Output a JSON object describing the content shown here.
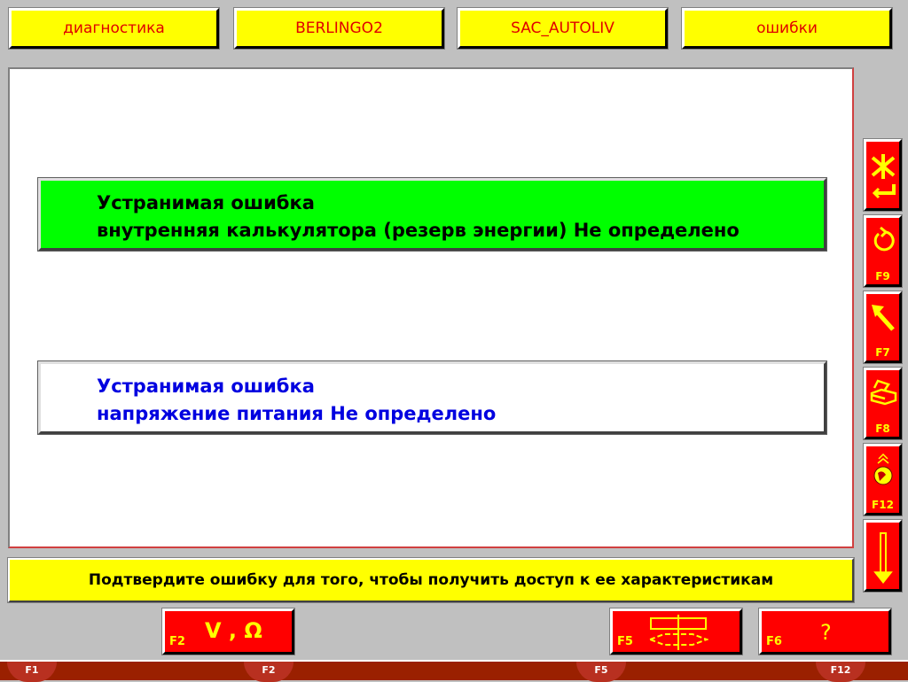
{
  "header": {
    "items": [
      "диагностика",
      "BERLINGO2",
      "SAC_AUTOLIV",
      "ошибки"
    ]
  },
  "faults": [
    {
      "line1": "Устранимая ошибка",
      "line2": "внутренняя калькулятора (резерв энергии) Не определено",
      "state": "selected",
      "bg": "#00ff00",
      "color": "#000000"
    },
    {
      "line1": "Устранимая ошибка",
      "line2": "напряжение питания Не определено",
      "state": "normal",
      "bg": "#ffffff",
      "color": "#0000e0"
    }
  ],
  "side_buttons": [
    {
      "icon": "confirm-icon",
      "key": ""
    },
    {
      "icon": "undo-icon",
      "key": "F9"
    },
    {
      "icon": "arrow-up-left-icon",
      "key": "F7"
    },
    {
      "icon": "print-icon",
      "key": "F8"
    },
    {
      "icon": "globe-icon",
      "key": "F12"
    },
    {
      "icon": "arrow-down-icon",
      "key": ""
    }
  ],
  "status": "Подтвердите ошибку для того, чтобы получить доступ к ее характеристикам",
  "bottom_buttons": [
    {
      "key": "F2",
      "label": "V , Ω"
    },
    {
      "key": "F5",
      "icon": "flowchart-icon"
    },
    {
      "key": "F6",
      "label": "?"
    }
  ],
  "strip_tabs": [
    "F1",
    "F2",
    "F5",
    "F12"
  ]
}
